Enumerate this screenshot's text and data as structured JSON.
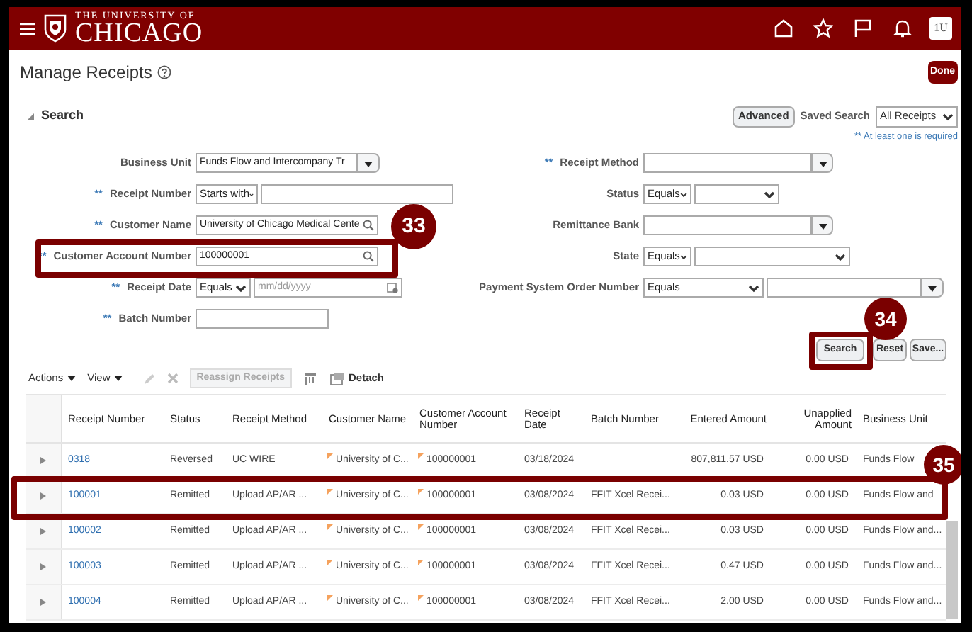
{
  "header": {
    "logo_tagline": "THE UNIVERSITY OF",
    "logo_wordmark": "CHICAGO",
    "avatar": "1U"
  },
  "page": {
    "title": "Manage Receipts",
    "done": "Done"
  },
  "search": {
    "title": "Search",
    "expanded": true,
    "advanced": "Advanced",
    "saved_search_label": "Saved Search",
    "saved_search": "All Receipts",
    "note": "** At least one is required",
    "left_fields": [
      {
        "kind": "combo",
        "label": "Business Unit",
        "value": "Funds Flow and Intercompany Tr"
      },
      {
        "kind": "operator_text",
        "marker": "**",
        "label": "Receipt Number",
        "operator": "Starts with"
      },
      {
        "kind": "search",
        "marker": "**",
        "label": "Customer Name",
        "value": "University of Chicago Medical Cente"
      },
      {
        "kind": "search",
        "marker": "**",
        "label": "Customer Account Number",
        "value": "100000001"
      },
      {
        "kind": "operator_date",
        "marker": "**",
        "label": "Receipt Date",
        "operator": "Equals",
        "placeholder": "mm/dd/yyyy"
      },
      {
        "kind": "text",
        "marker": "**",
        "label": "Batch Number"
      }
    ],
    "right_fields": [
      {
        "kind": "combo",
        "marker": "**",
        "label": "Receipt Method"
      },
      {
        "kind": "operator_select",
        "label": "Status",
        "operator": "Equals"
      },
      {
        "kind": "combo",
        "label": "Remittance Bank"
      },
      {
        "kind": "operator_select",
        "label": "State",
        "operator": "Equals"
      },
      {
        "kind": "operator_combo",
        "label": "Payment System Order Number",
        "operator": "Equals"
      }
    ],
    "buttons": [
      "Search",
      "Reset",
      "Save..."
    ]
  },
  "toolbar": {
    "actions": "Actions",
    "view": "View",
    "reassign": {
      "label": "Reassign Receipts",
      "disabled": true
    },
    "detach": "Detach"
  },
  "table": {
    "columns": [
      {
        "label": "Receipt Number",
        "kind": "link"
      },
      {
        "label": "Status",
        "kind": "text"
      },
      {
        "label": "Receipt Method",
        "kind": "text"
      },
      {
        "label": "Customer Name",
        "kind": "flagged"
      },
      {
        "label": "Customer Account Number",
        "kind": "flagged"
      },
      {
        "label": "Receipt Date",
        "kind": "text"
      },
      {
        "label": "Batch Number",
        "kind": "text"
      },
      {
        "label": "Entered Amount",
        "kind": "amount"
      },
      {
        "label": "Unapplied Amount",
        "kind": "amount"
      },
      {
        "label": "Business Unit",
        "kind": "text"
      }
    ],
    "rows": [
      {
        "cells": [
          "0318",
          "Reversed",
          "UC WIRE",
          "University of C...",
          "100000001",
          "03/18/2024",
          null,
          "807,811.57 USD",
          "0.00 USD",
          "Funds Flow"
        ]
      },
      {
        "cells": [
          "100001",
          "Remitted",
          "Upload AP/AR ...",
          "University of C...",
          "100000001",
          "03/08/2024",
          "FFIT Xcel Recei...",
          "0.03 USD",
          "0.00 USD",
          "Funds Flow and"
        ]
      },
      {
        "cells": [
          "100002",
          "Remitted",
          "Upload AP/AR ...",
          "University of C...",
          "100000001",
          "03/08/2024",
          "FFIT Xcel Recei...",
          "0.03 USD",
          "0.00 USD",
          "Funds Flow and..."
        ]
      },
      {
        "cells": [
          "100003",
          "Remitted",
          "Upload AP/AR ...",
          "University of C...",
          "100000001",
          "03/08/2024",
          "FFIT Xcel Recei...",
          "0.47 USD",
          "0.00 USD",
          "Funds Flow and..."
        ]
      },
      {
        "cells": [
          "100004",
          "Remitted",
          "Upload AP/AR ...",
          "University of C...",
          "100000001",
          "03/08/2024",
          "FFIT Xcel Recei...",
          "2.00 USD",
          "0.00 USD",
          "Funds Flow and..."
        ]
      }
    ]
  },
  "callouts": [
    {
      "number": "33"
    },
    {
      "number": "34"
    },
    {
      "number": "35"
    }
  ]
}
